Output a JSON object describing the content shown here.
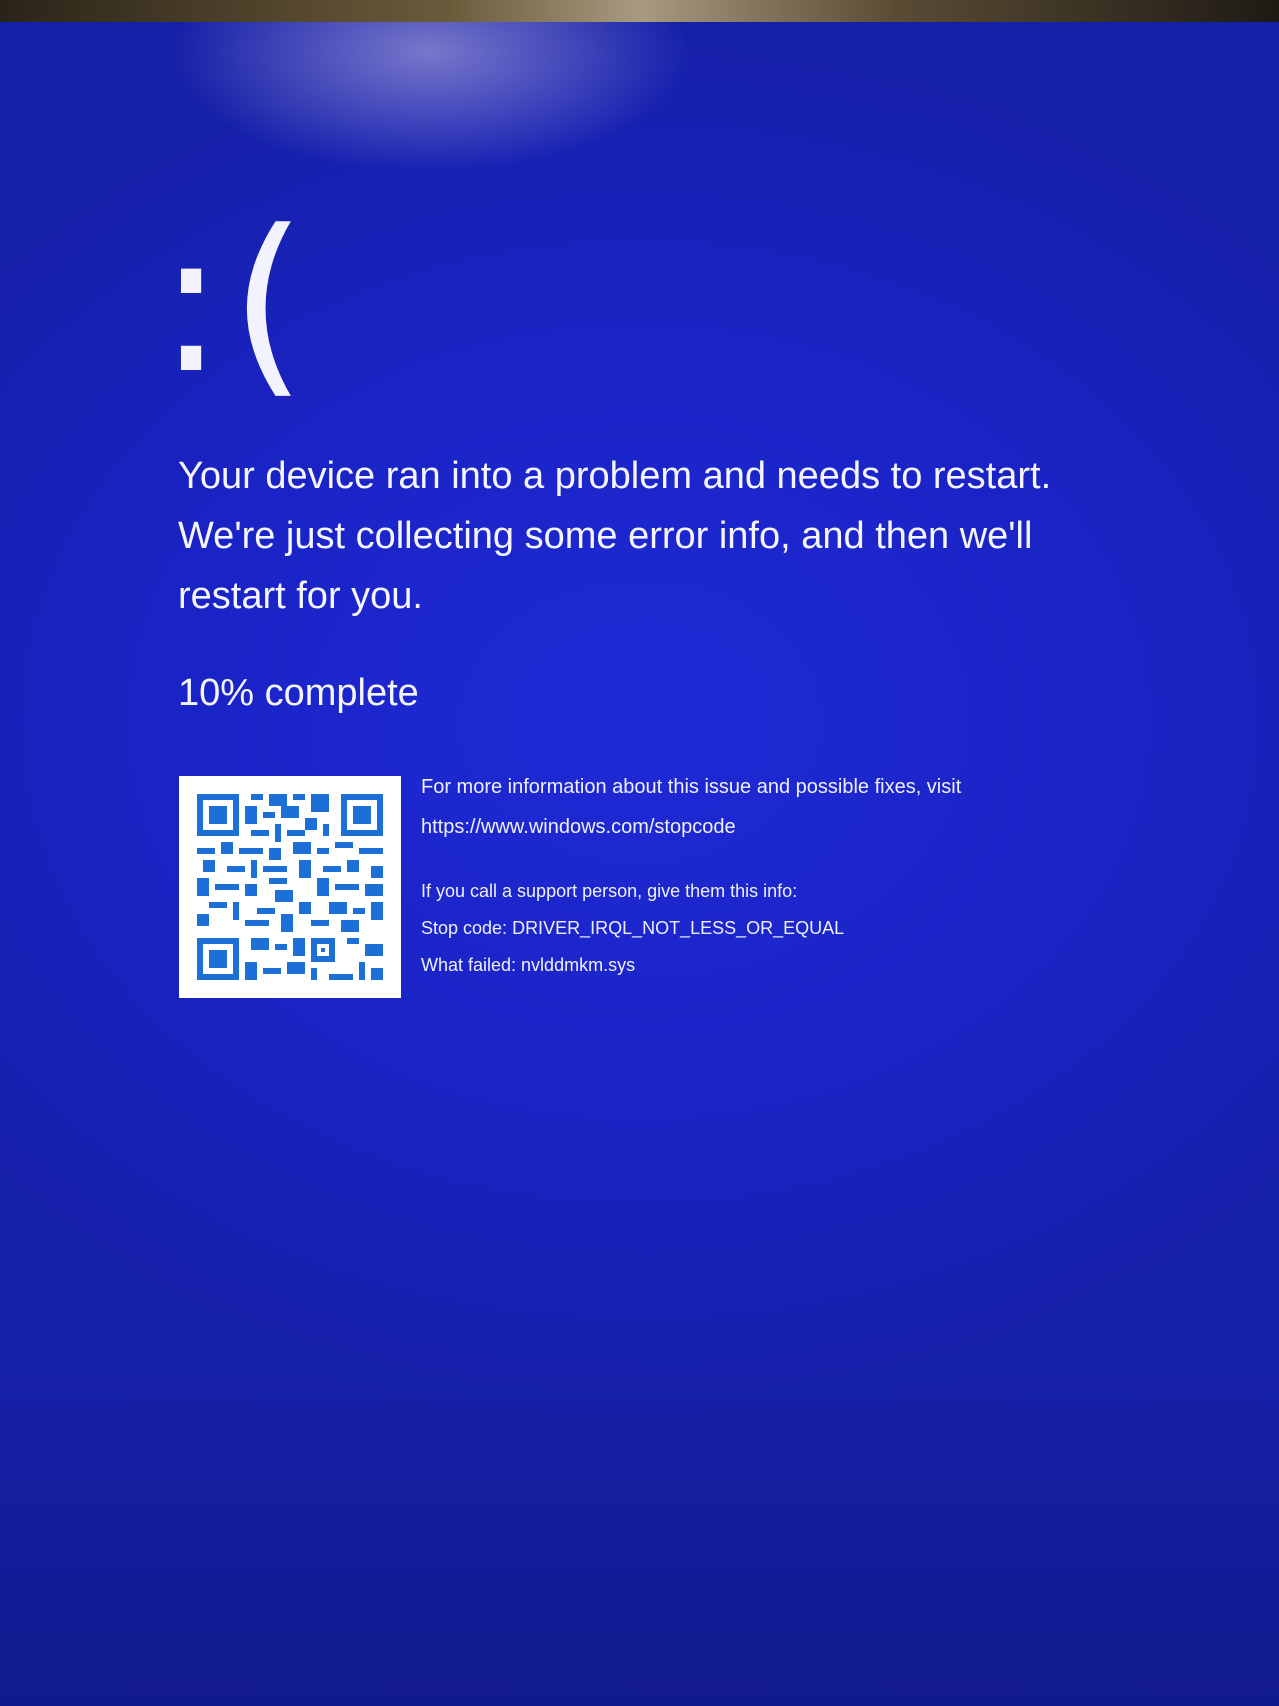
{
  "screen": {
    "sad_face": ":(",
    "message": "Your device ran into a problem and needs to restart.\nWe're just collecting some error info, and then we'll\nrestart for you.",
    "progress_text": "10% complete",
    "progress_percent": 10
  },
  "info": {
    "more_info_text": "For more information about this issue and possible fixes, visit",
    "url": "https://www.windows.com/stopcode",
    "support_text": "If you call a support person, give them this info:",
    "stop_code_text": "Stop code: DRIVER_IRQL_NOT_LESS_OR_EQUAL",
    "what_failed_text": "What failed: nvlddmkm.sys"
  },
  "qr_code": {
    "icon": "qr-code-icon"
  },
  "colors": {
    "background": "#1c24c8",
    "text": "#ffffff",
    "qr_module": "#1d6fd8",
    "qr_background": "#ffffff"
  }
}
